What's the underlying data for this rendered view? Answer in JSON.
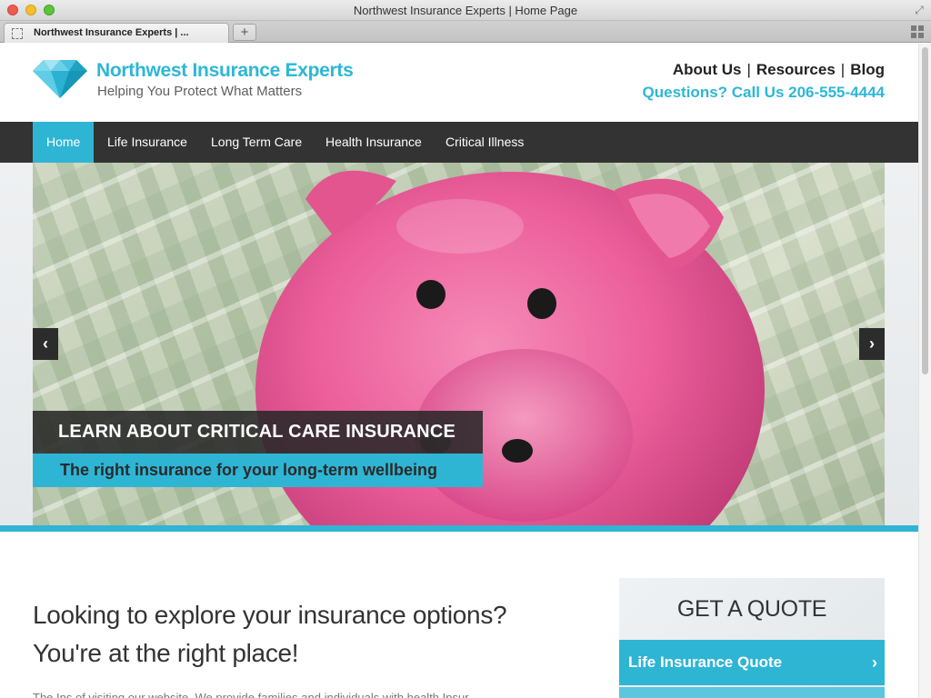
{
  "window": {
    "title": "Northwest Insurance Experts | Home Page",
    "tab_label": "Northwest Insurance Experts | ...",
    "new_tab_symbol": "+"
  },
  "brand": {
    "name": "Northwest Insurance Experts",
    "tagline": "Helping You Protect What Matters",
    "logo_icon": "diamond-icon",
    "accent_color": "#2db7d6"
  },
  "header": {
    "links": [
      "About Us",
      "Resources",
      "Blog"
    ],
    "separator": "|",
    "phone_text": "Questions? Call Us 206-555-4444"
  },
  "nav": {
    "items": [
      "Home",
      "Life Insurance",
      "Long Term Care",
      "Health Insurance",
      "Critical Illness"
    ],
    "active_index": 0
  },
  "hero": {
    "caption_title": "LEARN ABOUT CRITICAL CARE INSURANCE",
    "caption_sub": "The right insurance for your long-term wellbeing",
    "prev_icon": "chevron-left-icon",
    "next_icon": "chevron-right-icon"
  },
  "main": {
    "headline": "Looking to explore your insurance options? You're at the right place!",
    "body_text": "The Ins of visiting our website. We provide families and individuals with health Insur..."
  },
  "quote": {
    "title": "GET A QUOTE",
    "buttons": [
      "Life Insurance Quote"
    ]
  }
}
